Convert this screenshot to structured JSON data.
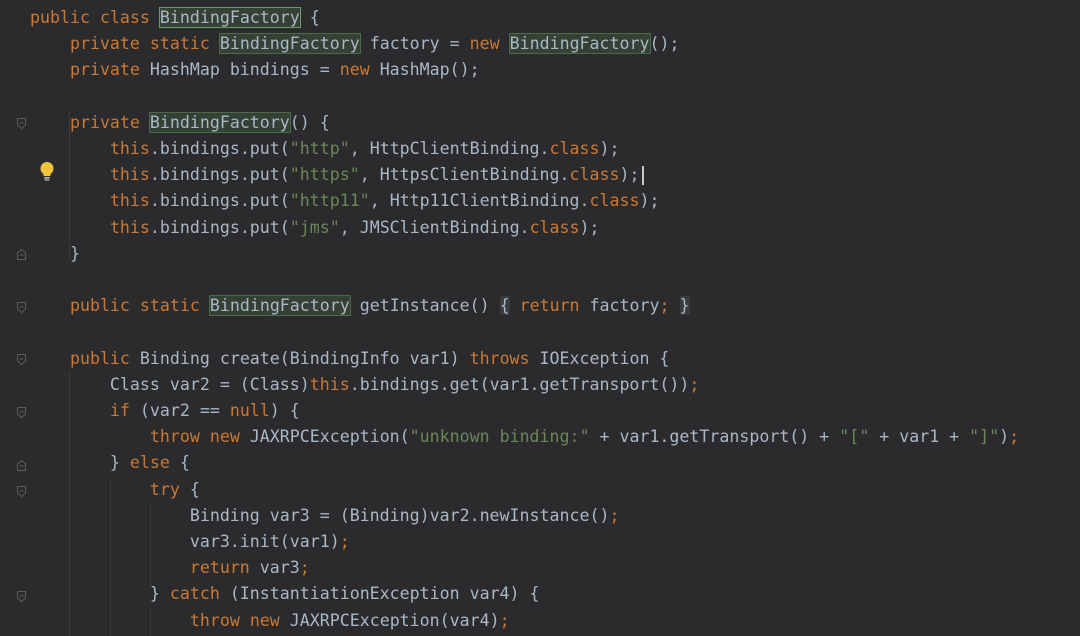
{
  "editor": {
    "lines": [
      [
        {
          "t": "public",
          "c": "kw"
        },
        {
          "t": " "
        },
        {
          "t": "class",
          "c": "kw"
        },
        {
          "t": " "
        },
        {
          "t": "BindingFactory",
          "c": "hl-sel"
        },
        {
          "t": " {"
        }
      ],
      [
        {
          "t": "    "
        },
        {
          "t": "private",
          "c": "kw"
        },
        {
          "t": " "
        },
        {
          "t": "static",
          "c": "kw"
        },
        {
          "t": " "
        },
        {
          "t": "BindingFactory",
          "c": "hl"
        },
        {
          "t": " factory = "
        },
        {
          "t": "new",
          "c": "kw"
        },
        {
          "t": " "
        },
        {
          "t": "BindingFactory",
          "c": "hl"
        },
        {
          "t": "();"
        }
      ],
      [
        {
          "t": "    "
        },
        {
          "t": "private",
          "c": "kw"
        },
        {
          "t": " HashMap bindings = "
        },
        {
          "t": "new",
          "c": "kw"
        },
        {
          "t": " HashMap();"
        }
      ],
      [],
      [
        {
          "t": "    "
        },
        {
          "t": "private",
          "c": "kw"
        },
        {
          "t": " "
        },
        {
          "t": "BindingFactory",
          "c": "hl"
        },
        {
          "t": "() {"
        }
      ],
      [
        {
          "t": "        "
        },
        {
          "t": "this",
          "c": "kw"
        },
        {
          "t": ".bindings.put("
        },
        {
          "t": "\"http\"",
          "c": "str"
        },
        {
          "t": ", HttpClientBinding."
        },
        {
          "t": "class",
          "c": "kw"
        },
        {
          "t": ");"
        }
      ],
      [
        {
          "t": "        "
        },
        {
          "t": "this",
          "c": "kw"
        },
        {
          "t": ".bindings.put("
        },
        {
          "t": "\"https\"",
          "c": "str"
        },
        {
          "t": ", HttpsClientBinding."
        },
        {
          "t": "class",
          "c": "kw"
        },
        {
          "t": ");"
        }
      ],
      [
        {
          "t": "        "
        },
        {
          "t": "this",
          "c": "kw"
        },
        {
          "t": ".bindings.put("
        },
        {
          "t": "\"http11\"",
          "c": "str"
        },
        {
          "t": ", Http11ClientBinding."
        },
        {
          "t": "class",
          "c": "kw"
        },
        {
          "t": ");"
        }
      ],
      [
        {
          "t": "        "
        },
        {
          "t": "this",
          "c": "kw"
        },
        {
          "t": ".bindings.put("
        },
        {
          "t": "\"jms\"",
          "c": "str"
        },
        {
          "t": ", JMSClientBinding."
        },
        {
          "t": "class",
          "c": "kw"
        },
        {
          "t": ");"
        }
      ],
      [
        {
          "t": "    }"
        }
      ],
      [],
      [
        {
          "t": "    "
        },
        {
          "t": "public",
          "c": "kw"
        },
        {
          "t": " "
        },
        {
          "t": "static",
          "c": "kw"
        },
        {
          "t": " "
        },
        {
          "t": "BindingFactory",
          "c": "hl"
        },
        {
          "t": " getInstance() "
        },
        {
          "t": "{",
          "c": "fb"
        },
        {
          "t": " "
        },
        {
          "t": "return",
          "c": "kw"
        },
        {
          "t": " factory"
        },
        {
          "t": ";",
          "c": "kw"
        },
        {
          "t": " "
        },
        {
          "t": "}",
          "c": "fb"
        }
      ],
      [],
      [
        {
          "t": "    "
        },
        {
          "t": "public",
          "c": "kw"
        },
        {
          "t": " Binding create(BindingInfo var1) "
        },
        {
          "t": "throws",
          "c": "kw"
        },
        {
          "t": " IOException {"
        }
      ],
      [
        {
          "t": "        Class var2 = (Class)"
        },
        {
          "t": "this",
          "c": "kw"
        },
        {
          "t": ".bindings.get(var1.getTransport())"
        },
        {
          "t": ";",
          "c": "kw"
        }
      ],
      [
        {
          "t": "        "
        },
        {
          "t": "if",
          "c": "kw"
        },
        {
          "t": " (var2 == "
        },
        {
          "t": "null",
          "c": "kw"
        },
        {
          "t": ") {"
        }
      ],
      [
        {
          "t": "            "
        },
        {
          "t": "throw",
          "c": "kw"
        },
        {
          "t": " "
        },
        {
          "t": "new",
          "c": "kw"
        },
        {
          "t": " JAXRPCException("
        },
        {
          "t": "\"unknown binding:\"",
          "c": "str"
        },
        {
          "t": " + var1.getTransport() + "
        },
        {
          "t": "\"[\"",
          "c": "str"
        },
        {
          "t": " + var1 + "
        },
        {
          "t": "\"]\"",
          "c": "str"
        },
        {
          "t": ")"
        },
        {
          "t": ";",
          "c": "kw"
        }
      ],
      [
        {
          "t": "        } "
        },
        {
          "t": "else",
          "c": "kw"
        },
        {
          "t": " {"
        }
      ],
      [
        {
          "t": "            "
        },
        {
          "t": "try",
          "c": "kw"
        },
        {
          "t": " {"
        }
      ],
      [
        {
          "t": "                Binding var3 = (Binding)var2.newInstance()"
        },
        {
          "t": ";",
          "c": "kw"
        }
      ],
      [
        {
          "t": "                var3.init(var1)"
        },
        {
          "t": ";",
          "c": "kw"
        }
      ],
      [
        {
          "t": "                "
        },
        {
          "t": "return",
          "c": "kw"
        },
        {
          "t": " var3"
        },
        {
          "t": ";",
          "c": "kw"
        }
      ],
      [
        {
          "t": "            } "
        },
        {
          "t": "catch",
          "c": "kw"
        },
        {
          "t": " (InstantiationException var4) {"
        }
      ],
      [
        {
          "t": "                "
        },
        {
          "t": "throw",
          "c": "kw"
        },
        {
          "t": " "
        },
        {
          "t": "new",
          "c": "kw"
        },
        {
          "t": " JAXRPCException(var4)"
        },
        {
          "t": ";",
          "c": "kw"
        }
      ]
    ]
  },
  "colors": {
    "background": "#2b2b2d",
    "keyword": "#cc7832",
    "string": "#6a8759",
    "default": "#a9b7c6",
    "usage_highlight": "#344134"
  },
  "gutter": {
    "bulb_icon": "lightbulb-icon",
    "fold_icon": "fold-marker-icon"
  }
}
